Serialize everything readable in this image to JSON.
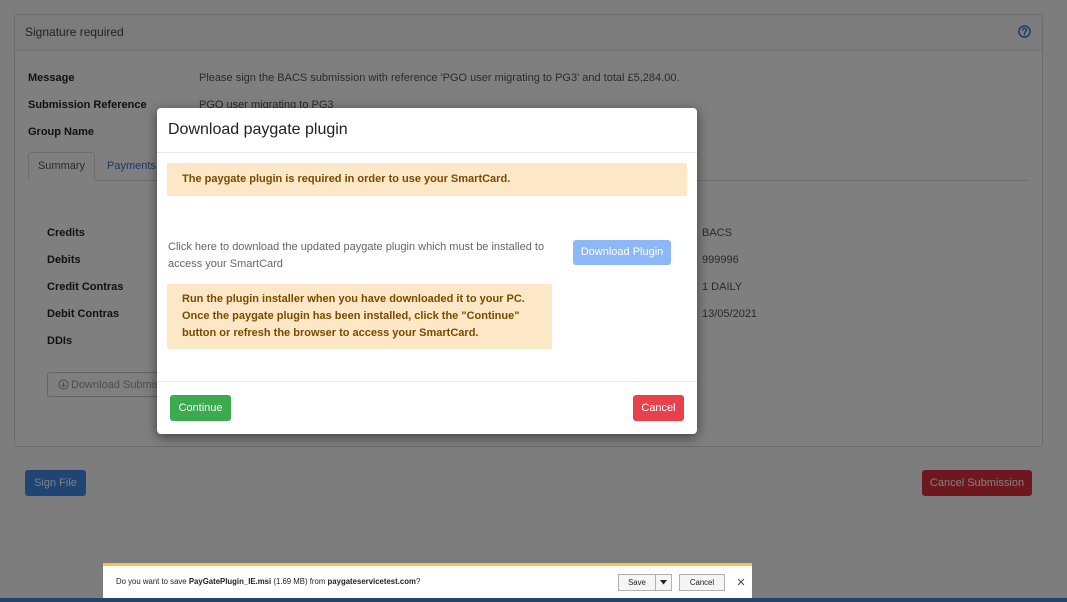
{
  "card": {
    "title": "Signature required",
    "help_icon": "question-circle-icon",
    "fields": {
      "message": {
        "label": "Message",
        "value": "Please sign the BACS submission with reference 'PGO user migrating to PG3' and total £5,284.00."
      },
      "submission_reference": {
        "label": "Submission Reference",
        "value": "PGO user migrating to PG3"
      },
      "group_name": {
        "label": "Group Name"
      }
    },
    "tabs": [
      {
        "label": "Summary",
        "active": true
      },
      {
        "label": "Payments",
        "active": false
      }
    ],
    "summary": {
      "left_labels": [
        "Credits",
        "Debits",
        "Credit Contras",
        "Debit Contras",
        "DDIs"
      ],
      "right_values": [
        "BACS",
        "999996",
        "1 DAILY",
        "13/05/2021"
      ]
    },
    "download_submission_button": {
      "icon": "download-circle-icon",
      "label": "Download Submis"
    }
  },
  "actions": {
    "sign_file": "Sign File",
    "cancel_submission": "Cancel Submission"
  },
  "modal": {
    "title": "Download paygate plugin",
    "notice": "The paygate plugin is required in order to use your SmartCard.",
    "instructions_lines": [
      "Click here to download the updated paygate plugin which must be installed to",
      "access your SmartCard"
    ],
    "download_plugin_button": "Download Plugin",
    "installer_note_lines": [
      "Run the plugin installer when you have downloaded it to your PC.",
      "Once the paygate plugin has been installed, click the \"Continue\"",
      "button or refresh the browser to access your SmartCard."
    ],
    "continue_button": "Continue",
    "cancel_button": "Cancel"
  },
  "download_bar": {
    "prompt_start": "Do you want to save",
    "file_name": "PayGatePlugin_IE.msi",
    "file_size_and_from": "(1.69 MB) from",
    "host": "paygateservicetest.com",
    "prompt_end": "?",
    "save_button": "Save",
    "save_menu_icon": "chevron-down-icon",
    "cancel_button": "Cancel",
    "close_icon": "close-icon"
  },
  "colors": {
    "primary": "#3d8be6",
    "danger": "#df2f3c",
    "success": "#3bab4f",
    "warning_bg": "#fce7c6",
    "warning_text": "#7a4b00",
    "plugin_button": "#8db8f7",
    "link": "#3572d6"
  }
}
